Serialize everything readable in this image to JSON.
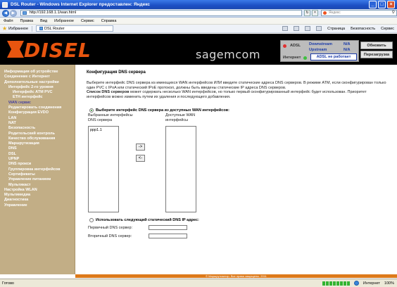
{
  "window": {
    "title": "DSL Router - Windows Internet Explorer предоставлен: Яндекс"
  },
  "address": {
    "url": "http://192.168.1.1/wan.html",
    "search_placeholder": "Яндекс"
  },
  "menu": [
    "Файл",
    "Правка",
    "Вид",
    "Избранное",
    "Сервис",
    "Справка"
  ],
  "favorites": {
    "label": "Избранное",
    "tab_label": "DSL Router"
  },
  "commandbar": {
    "page": "Страница",
    "security": "Безопасность",
    "service": "Сервис"
  },
  "header": {
    "brand": "Sagemcom",
    "status": {
      "adsl": "ADSL",
      "downstream": "Downstream",
      "upstream": "Upstream",
      "down_val": "N/A",
      "up_val": "N/A",
      "internet": "Интернет",
      "dsl_state": "ADSL не работает"
    },
    "refresh_button": "Обновить",
    "reboot_button": "Перезагрузка"
  },
  "sidebar": [
    {
      "label": "Информация об устройстве",
      "level": 0
    },
    {
      "label": "Соединение с Интернет",
      "level": 0
    },
    {
      "label": "Дополнительные настройки",
      "level": 0
    },
    {
      "label": "Интерфейс 2-го уровня",
      "level": 1
    },
    {
      "label": "Интерфейс ATM PVC",
      "level": 2
    },
    {
      "label": "ETH интерфейс",
      "level": 2
    },
    {
      "label": "WAN сервис",
      "level": 1,
      "active": true
    },
    {
      "label": "Редактировать соединения",
      "level": 1
    },
    {
      "label": "Конфигурация EVDO",
      "level": 1
    },
    {
      "label": "LAN",
      "level": 1
    },
    {
      "label": "NAT",
      "level": 1
    },
    {
      "label": "Безопасность",
      "level": 1
    },
    {
      "label": "Родительский контроль",
      "level": 1
    },
    {
      "label": "Качество обслуживания",
      "level": 1
    },
    {
      "label": "Маршрутизация",
      "level": 1
    },
    {
      "label": "DNS",
      "level": 1
    },
    {
      "label": "DSL",
      "level": 1
    },
    {
      "label": "UPNP",
      "level": 1
    },
    {
      "label": "DNS прокси",
      "level": 1
    },
    {
      "label": "Группировка интерфейсов",
      "level": 1
    },
    {
      "label": "Сертификаты",
      "level": 1
    },
    {
      "label": "Управление питанием",
      "level": 1
    },
    {
      "label": "Мультикаст",
      "level": 1
    },
    {
      "label": "Настройка WLAN",
      "level": 0
    },
    {
      "label": "Мультимедиа",
      "level": 0
    },
    {
      "label": "Диагностика",
      "level": 0
    },
    {
      "label": "Управление",
      "level": 0
    }
  ],
  "content": {
    "title": "Конфигурация DNS сервера",
    "desc1": "Выберите интерфейс DNS сервера из имеющихся WAN интерфейсов ИЛИ введите статические адреса DNS серверов. В режиме ATM, если сконфигурирован только один PVC с IPoA или статический IPoE протокол, должны быть введены статические IP адреса DNS серверов.",
    "desc2_bold": "Список DNS серверов",
    "desc2": " может содержать несколько WAN интерфейсов, но только первый сконфигурированный интерфейс будет использован. Приоритет интерфейсов можно изменить путем их удаления и последующего добавления.",
    "option1": "Выберите интерфейс DNS сервера из доступных WAN интерфейсов:",
    "selected_label": "Выбранные интерфейсы DNS сервера",
    "available_label": "Доступные WAN интерфейсы",
    "selected_items": [
      "ppp1.1"
    ],
    "arrow_right": "->",
    "arrow_left": "<-",
    "option2": "Использовать следующий статический DNS IP адрес:",
    "primary_label": "Первичный DNS сервер:",
    "secondary_label": "Вторичный DNS сервер:"
  },
  "footer": "© Маршрутизатор. Все права защищены. 2011",
  "statusbar": {
    "left": "Готово",
    "zone": "Интернет",
    "zoom": "100%"
  }
}
